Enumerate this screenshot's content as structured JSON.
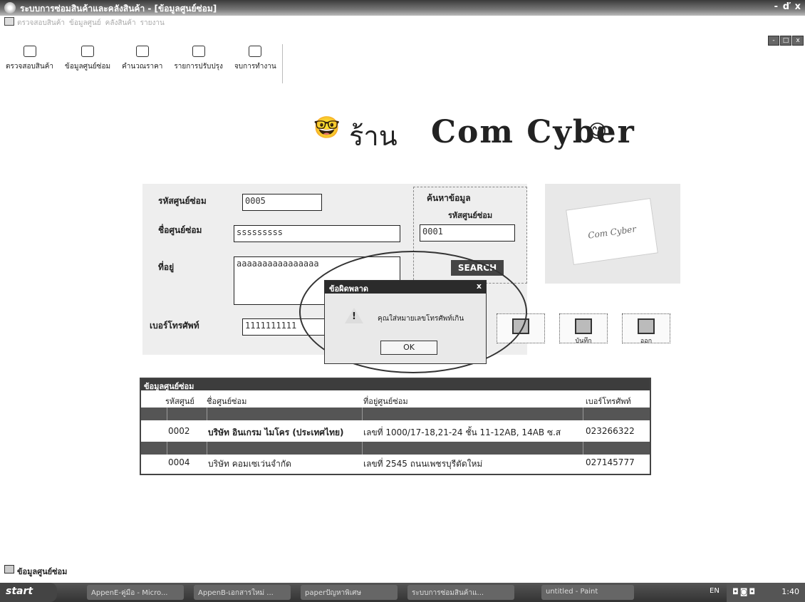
{
  "window": {
    "title": "ระบบการซ่อมสินค้าและคลังสินค้า - [ข้อมูลศูนย์ซ่อม]",
    "min": "-",
    "restore": "ď",
    "close": "x"
  },
  "menubar": {
    "items": [
      "ตรวจสอบสินค้า",
      "ข้อมูลศูนย์",
      "คลังสินค้า",
      "รายงาน"
    ]
  },
  "mdi_buttons": [
    "-",
    "□",
    "x"
  ],
  "toolbar": {
    "buttons": [
      "ตรวจสอบสินค้า",
      "ข้อมูลศูนย์ซ่อม",
      "คำนวณราคา",
      "รายการปรับปรุง",
      "จบการทำงาน"
    ]
  },
  "banner": {
    "emoji_left": "🤓",
    "shop": "ร้าน",
    "brand": "Com Cyber",
    "emoji_right": "😊"
  },
  "form": {
    "id_label": "รหัสศูนย์ซ่อม",
    "id_value": "0005",
    "name_label": "ชื่อศูนย์ซ่อม",
    "name_value": "sssssssss",
    "address_label": "ที่อยู่",
    "address_value": "aaaaaaaaaaaaaaaa",
    "phone_label": "เบอร์โทรศัพท์",
    "phone_value": "1111111111"
  },
  "search": {
    "title": "ค้นหาข้อมูล",
    "label": "รหัสศูนย์ซ่อม",
    "value": "0001",
    "button": "SEARCH"
  },
  "logo_text": "Com Cyber",
  "actions": {
    "save": "บันทึก",
    "exit": "ออก"
  },
  "grid": {
    "caption": "ข้อมูลศูนย์ซ่อม",
    "headers": [
      "รหัสศูนย์",
      "ชื่อศูนย์ซ่อม",
      "ที่อยู่ศูนย์ซ่อม",
      "เบอร์โทรศัพท์"
    ],
    "rows": [
      {
        "id": "0002",
        "name": "บริษัท อินเกรม ไมโคร (ประเทศไทย)",
        "address": "เลขที่ 1000/17-18,21-24 ชั้น 11-12AB, 14AB ซ.ส",
        "phone": "023266322"
      },
      {
        "id": "0004",
        "name": "บริษัท คอมเซเว่นจำกัด",
        "address": "เลขที่ 2545 ถนนเพชรบุรีตัดใหม่",
        "phone": "027145777"
      }
    ]
  },
  "dialog": {
    "title": "ข้อผิดพลาด",
    "close": "x",
    "icon": "!",
    "message": "คุณใส่หมายเลขโทรศัพท์เกิน",
    "ok": "OK"
  },
  "status": {
    "text": "ข้อมูลศูนย์ซ่อม"
  },
  "taskbar": {
    "start": "start",
    "tasks": [
      "AppenE-คู่มือ - Micro...",
      "AppenB-เอกสารใหม่ ...",
      "paperปัญหาพิเศษ",
      "ระบบการซ่อมสินค้าแ...",
      "untitled - Paint"
    ],
    "lang": "EN",
    "clock": "1:40"
  }
}
